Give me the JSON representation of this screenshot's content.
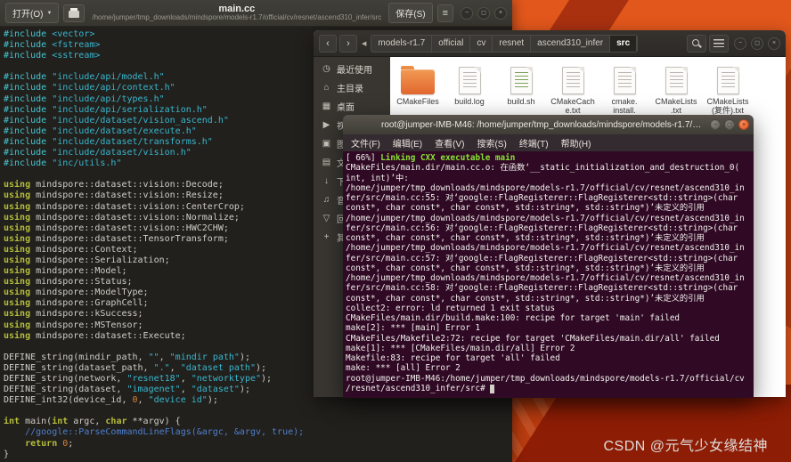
{
  "chrome": {
    "minimize_glyph": "−",
    "maximize_glyph": "◻",
    "close_glyph": "×"
  },
  "desktop": {
    "watermark": "CSDN @元气少女缘结神"
  },
  "colors": {
    "wallpaper_orange": "#E2571C",
    "wallpaper_dark_red": "#8E1D05",
    "terminal_background": "#300A24",
    "terminal_green": "#8AE234",
    "folder_orange": "#E8773A"
  },
  "editor": {
    "open_label": "打开(O)",
    "open_caret": "▼",
    "title": "main.cc",
    "subtitle": "/home/jumper/tmp_downloads/mindspore/models-r1.7/official/cv/resnet/ascend310_infer/src",
    "save_label": "保存(S)",
    "hamburger_glyph": "≡",
    "code_lines": [
      [
        [
          "pp",
          "#include"
        ],
        [
          "t",
          " "
        ],
        [
          "s",
          "<vector>"
        ]
      ],
      [
        [
          "pp",
          "#include"
        ],
        [
          "t",
          " "
        ],
        [
          "s",
          "<fstream>"
        ]
      ],
      [
        [
          "pp",
          "#include"
        ],
        [
          "t",
          " "
        ],
        [
          "s",
          "<sstream>"
        ]
      ],
      [],
      [
        [
          "pp",
          "#include"
        ],
        [
          "t",
          " "
        ],
        [
          "s",
          "\"include/api/model.h\""
        ]
      ],
      [
        [
          "pp",
          "#include"
        ],
        [
          "t",
          " "
        ],
        [
          "s",
          "\"include/api/context.h\""
        ]
      ],
      [
        [
          "pp",
          "#include"
        ],
        [
          "t",
          " "
        ],
        [
          "s",
          "\"include/api/types.h\""
        ]
      ],
      [
        [
          "pp",
          "#include"
        ],
        [
          "t",
          " "
        ],
        [
          "s",
          "\"include/api/serialization.h\""
        ]
      ],
      [
        [
          "pp",
          "#include"
        ],
        [
          "t",
          " "
        ],
        [
          "s",
          "\"include/dataset/vision_ascend.h\""
        ]
      ],
      [
        [
          "pp",
          "#include"
        ],
        [
          "t",
          " "
        ],
        [
          "s",
          "\"include/dataset/execute.h\""
        ]
      ],
      [
        [
          "pp",
          "#include"
        ],
        [
          "t",
          " "
        ],
        [
          "s",
          "\"include/dataset/transforms.h\""
        ]
      ],
      [
        [
          "pp",
          "#include"
        ],
        [
          "t",
          " "
        ],
        [
          "s",
          "\"include/dataset/vision.h\""
        ]
      ],
      [
        [
          "pp",
          "#include"
        ],
        [
          "t",
          " "
        ],
        [
          "s",
          "\"inc/utils.h\""
        ]
      ],
      [],
      [
        [
          "k",
          "using"
        ],
        [
          "t",
          " mindspore::dataset::vision::Decode;"
        ]
      ],
      [
        [
          "k",
          "using"
        ],
        [
          "t",
          " mindspore::dataset::vision::Resize;"
        ]
      ],
      [
        [
          "k",
          "using"
        ],
        [
          "t",
          " mindspore::dataset::vision::CenterCrop;"
        ]
      ],
      [
        [
          "k",
          "using"
        ],
        [
          "t",
          " mindspore::dataset::vision::Normalize;"
        ]
      ],
      [
        [
          "k",
          "using"
        ],
        [
          "t",
          " mindspore::dataset::vision::HWC2CHW;"
        ]
      ],
      [
        [
          "k",
          "using"
        ],
        [
          "t",
          " mindspore::dataset::TensorTransform;"
        ]
      ],
      [
        [
          "k",
          "using"
        ],
        [
          "t",
          " mindspore::Context;"
        ]
      ],
      [
        [
          "k",
          "using"
        ],
        [
          "t",
          " mindspore::Serialization;"
        ]
      ],
      [
        [
          "k",
          "using"
        ],
        [
          "t",
          " mindspore::Model;"
        ]
      ],
      [
        [
          "k",
          "using"
        ],
        [
          "t",
          " mindspore::Status;"
        ]
      ],
      [
        [
          "k",
          "using"
        ],
        [
          "t",
          " mindspore::ModelType;"
        ]
      ],
      [
        [
          "k",
          "using"
        ],
        [
          "t",
          " mindspore::GraphCell;"
        ]
      ],
      [
        [
          "k",
          "using"
        ],
        [
          "t",
          " mindspore::kSuccess;"
        ]
      ],
      [
        [
          "k",
          "using"
        ],
        [
          "t",
          " mindspore::MSTensor;"
        ]
      ],
      [
        [
          "k",
          "using"
        ],
        [
          "t",
          " mindspore::dataset::Execute;"
        ]
      ],
      [],
      [
        [
          "t",
          "DEFINE_string(mindir_path, "
        ],
        [
          "s",
          "\"\""
        ],
        [
          "t",
          ", "
        ],
        [
          "s",
          "\"mindir path\""
        ],
        [
          "t",
          ");"
        ]
      ],
      [
        [
          "t",
          "DEFINE_string(dataset_path, "
        ],
        [
          "s",
          "\".\""
        ],
        [
          "t",
          ", "
        ],
        [
          "s",
          "\"dataset path\""
        ],
        [
          "t",
          ");"
        ]
      ],
      [
        [
          "t",
          "DEFINE_string(network, "
        ],
        [
          "s",
          "\"resnet18\""
        ],
        [
          "t",
          ", "
        ],
        [
          "s",
          "\"networktype\""
        ],
        [
          "t",
          ");"
        ]
      ],
      [
        [
          "t",
          "DEFINE_string(dataset, "
        ],
        [
          "s",
          "\"imagenet\""
        ],
        [
          "t",
          ", "
        ],
        [
          "s",
          "\"dataset\""
        ],
        [
          "t",
          ");"
        ]
      ],
      [
        [
          "t",
          "DEFINE_int32(device_id, "
        ],
        [
          "n",
          "0"
        ],
        [
          "t",
          ", "
        ],
        [
          "s",
          "\"device id\""
        ],
        [
          "t",
          ");"
        ]
      ],
      [],
      [
        [
          "k",
          "int"
        ],
        [
          "t",
          " main("
        ],
        [
          "k",
          "int"
        ],
        [
          "t",
          " argc, "
        ],
        [
          "k",
          "char"
        ],
        [
          "t",
          " **argv) {"
        ]
      ],
      [
        [
          "t",
          "    "
        ],
        [
          "c",
          "//google::ParseCommandLineFlags(&argc, &argv, true);"
        ]
      ],
      [
        [
          "t",
          "    "
        ],
        [
          "k",
          "return"
        ],
        [
          "t",
          " "
        ],
        [
          "n",
          "0"
        ],
        [
          "t",
          ";"
        ]
      ],
      [
        [
          "t",
          "}"
        ]
      ]
    ]
  },
  "files": {
    "back_icon": "‹",
    "forward_icon": "›",
    "pager_icon": "◀",
    "breadcrumbs": [
      {
        "label": "models-r1.7",
        "active": false
      },
      {
        "label": "official",
        "active": false
      },
      {
        "label": "cv",
        "active": false
      },
      {
        "label": "resnet",
        "active": false
      },
      {
        "label": "ascend310_infer",
        "active": false
      },
      {
        "label": "src",
        "active": true
      }
    ],
    "sidebar": [
      {
        "icon": "◷",
        "label": "最近使用"
      },
      {
        "icon": "⌂",
        "label": "主目录"
      },
      {
        "icon": "▦",
        "label": "桌面"
      },
      {
        "icon": "▶",
        "label": "视频"
      },
      {
        "icon": "▣",
        "label": "图片"
      },
      {
        "icon": "▤",
        "label": "文档"
      },
      {
        "icon": "↓",
        "label": "下载"
      },
      {
        "icon": "♫",
        "label": "音乐"
      },
      {
        "icon": "▽",
        "label": "回收站"
      },
      {
        "icon": "+",
        "label": "其他位置"
      }
    ],
    "items": [
      {
        "name": "CMakeFiles",
        "type": "folder"
      },
      {
        "name": "build.log",
        "type": "file"
      },
      {
        "name": "build.sh",
        "type": "script"
      },
      {
        "name": "CMakeCach\ne.txt",
        "type": "file"
      },
      {
        "name": "cmake.\ninstall.\ncmake",
        "type": "file"
      },
      {
        "name": "CMakeLists\n.txt",
        "type": "file"
      },
      {
        "name": "CMakeLists\n(复件).txt",
        "type": "file"
      }
    ]
  },
  "terminal": {
    "title": "root@jumper-IMB-M46: /home/jumper/tmp_downloads/mindspore/models-r1.7/official/cv/r...",
    "menus": [
      "文件(F)",
      "编辑(E)",
      "查看(V)",
      "搜索(S)",
      "终端(T)",
      "帮助(H)"
    ],
    "lines": [
      [
        [
          "w",
          "[ 66%] "
        ],
        [
          "g",
          "Linking CXX executable main"
        ]
      ],
      [
        [
          "w",
          "CMakeFiles/main.dir/main.cc.o: 在函数‘__static_initialization_and_destruction_0("
        ]
      ],
      [
        [
          "w",
          "int, int)’中:"
        ]
      ],
      [
        [
          "w",
          "/home/jumper/tmp_downloads/mindspore/models-r1.7/official/cv/resnet/ascend310_in"
        ]
      ],
      [
        [
          "w",
          "fer/src/main.cc:55: 对‘google::FlagRegisterer::FlagRegisterer<std::string>(char"
        ]
      ],
      [
        [
          "w",
          "const*, char const*, char const*, std::string*, std::string*)’未定义的引用"
        ]
      ],
      [
        [
          "w",
          "/home/jumper/tmp_downloads/mindspore/models-r1.7/official/cv/resnet/ascend310_in"
        ]
      ],
      [
        [
          "w",
          "fer/src/main.cc:56: 对‘google::FlagRegisterer::FlagRegisterer<std::string>(char"
        ]
      ],
      [
        [
          "w",
          "const*, char const*, char const*, std::string*, std::string*)’未定义的引用"
        ]
      ],
      [
        [
          "w",
          "/home/jumper/tmp_downloads/mindspore/models-r1.7/official/cv/resnet/ascend310_in"
        ]
      ],
      [
        [
          "w",
          "fer/src/main.cc:57: 对‘google::FlagRegisterer::FlagRegisterer<std::string>(char"
        ]
      ],
      [
        [
          "w",
          "const*, char const*, char const*, std::string*, std::string*)’未定义的引用"
        ]
      ],
      [
        [
          "w",
          "/home/jumper/tmp_downloads/mindspore/models-r1.7/official/cv/resnet/ascend310_in"
        ]
      ],
      [
        [
          "w",
          "fer/src/main.cc:58: 对‘google::FlagRegisterer::FlagRegisterer<std::string>(char"
        ]
      ],
      [
        [
          "w",
          "const*, char const*, char const*, std::string*, std::string*)’未定义的引用"
        ]
      ],
      [
        [
          "w",
          "collect2: error: ld returned 1 exit status"
        ]
      ],
      [
        [
          "w",
          "CMakeFiles/main.dir/build.make:100: recipe for target 'main' failed"
        ]
      ],
      [
        [
          "w",
          "make[2]: *** [main] Error 1"
        ]
      ],
      [
        [
          "w",
          "CMakeFiles/Makefile2:72: recipe for target 'CMakeFiles/main.dir/all' failed"
        ]
      ],
      [
        [
          "w",
          "make[1]: *** [CMakeFiles/main.dir/all] Error 2"
        ]
      ],
      [
        [
          "w",
          "Makefile:83: recipe for target 'all' failed"
        ]
      ],
      [
        [
          "w",
          "make: *** [all] Error 2"
        ]
      ],
      [
        [
          "w",
          "root@jumper-IMB-M46:/home/jumper/tmp_downloads/mindspore/models-r1.7/official/cv"
        ]
      ],
      [
        [
          "w",
          "/resnet/ascend310_infer/src# "
        ],
        [
          "cur",
          " "
        ]
      ]
    ]
  }
}
